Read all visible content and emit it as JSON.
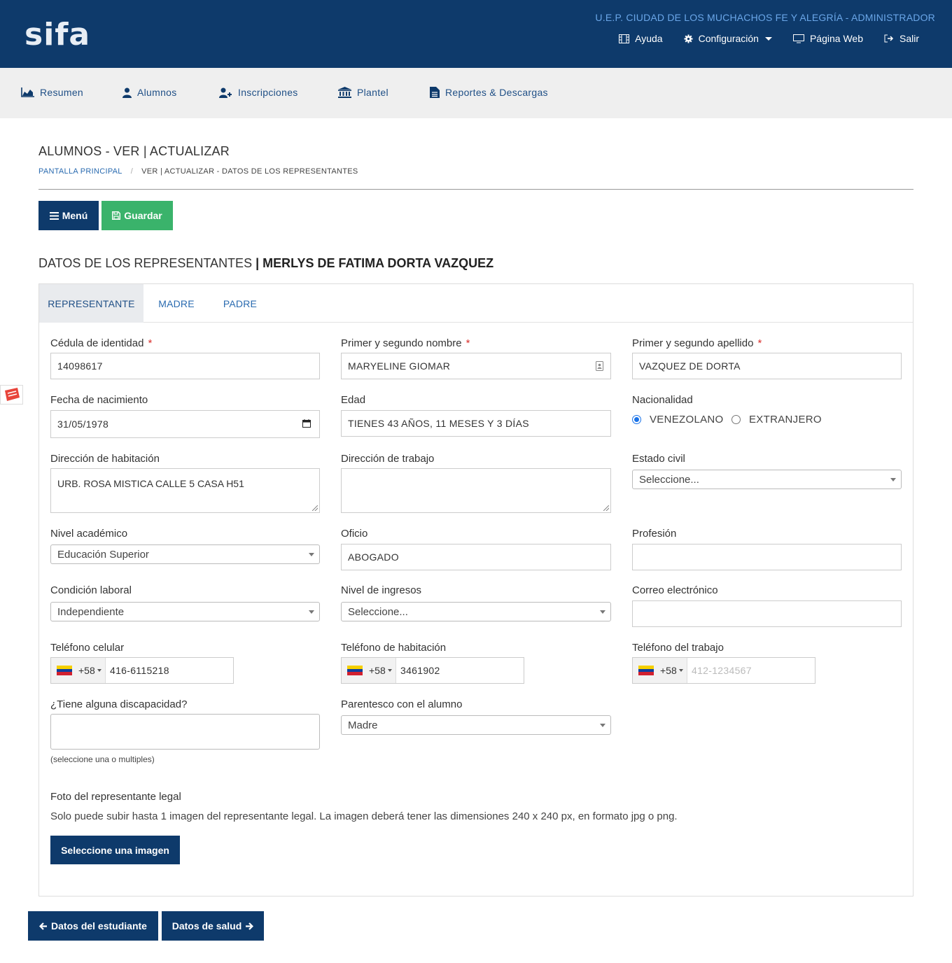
{
  "header": {
    "logo": "sifa",
    "school": "U.E.P. CIUDAD DE LOS MUCHACHOS FE Y ALEGRÍA - ADMINISTRADOR",
    "nav": {
      "help": "Ayuda",
      "settings": "Configuración",
      "website": "Página Web",
      "logout": "Salir"
    }
  },
  "subnav": {
    "summary": "Resumen",
    "students": "Alumnos",
    "enrollments": "Inscripciones",
    "campus": "Plantel",
    "reports": "Reportes & Descargas"
  },
  "page": {
    "title": "ALUMNOS - VER | ACTUALIZAR",
    "breadcrumb": {
      "home": "PANTALLA PRINCIPAL",
      "separator": "/",
      "current": "VER | ACTUALIZAR - DATOS DE LOS REPRESENTANTES"
    },
    "menu_button": "Menú",
    "save_button": "Guardar",
    "section_title": "DATOS DE LOS REPRESENTANTES",
    "section_name": "| MERLYS DE FATIMA DORTA VAZQUEZ"
  },
  "tabs": [
    "REPRESENTANTE",
    "MADRE",
    "PADRE"
  ],
  "form": {
    "required_mark": "*",
    "id_label": "Cédula de identidad",
    "id_value": "14098617",
    "first_name_label": "Primer y segundo nombre",
    "first_name_value": "MARYELINE GIOMAR",
    "last_name_label": "Primer y segundo apellido",
    "last_name_value": "VAZQUEZ DE DORTA",
    "birth_label": "Fecha de nacimiento",
    "birth_value": "31/05/1978",
    "age_label": "Edad",
    "age_value": "TIENES 43 AÑOS, 11 MESES Y 3 DÍAS",
    "nationality_label": "Nacionalidad",
    "nationality_options": [
      "VENEZOLANO",
      "EXTRANJERO"
    ],
    "home_address_label": "Dirección de habitación",
    "home_address_value": "URB. ROSA MISTICA CALLE 5 CASA H51",
    "work_address_label": "Dirección de trabajo",
    "work_address_value": "",
    "civil_status_label": "Estado civil",
    "civil_status_value": "Seleccione...",
    "academic_label": "Nivel académico",
    "academic_value": "Educación Superior",
    "occupation_label": "Oficio",
    "occupation_value": "ABOGADO",
    "profession_label": "Profesión",
    "profession_value": "",
    "work_condition_label": "Condición laboral",
    "work_condition_value": "Independiente",
    "income_label": "Nivel de ingresos",
    "income_value": "Seleccione...",
    "email_label": "Correo electrónico",
    "email_value": "",
    "cell_label": "Teléfono celular",
    "cell_code": "+58",
    "cell_value": "416-6115218",
    "home_phone_label": "Teléfono de habitación",
    "home_phone_code": "+58",
    "home_phone_value": "3461902",
    "work_phone_label": "Teléfono del trabajo",
    "work_phone_code": "+58",
    "work_phone_placeholder": "412-1234567",
    "disability_label": "¿Tiene alguna discapacidad?",
    "disability_hint": "(seleccione una o multiples)",
    "relationship_label": "Parentesco con el alumno",
    "relationship_value": "Madre",
    "photo_label": "Foto del representante legal",
    "photo_help": "Solo puede subir hasta 1 imagen del representante legal. La imagen deberá tener las dimensiones 240 x 240 px, en formato jpg o png.",
    "photo_button": "Seleccione una imagen"
  },
  "footer_nav": {
    "prev": "Datos del estudiante",
    "next": "Datos de salud"
  },
  "colors": {
    "brand": "#0e3a6b",
    "save": "#3ab36b",
    "link": "#2a6bb0",
    "required": "#d9302c"
  }
}
